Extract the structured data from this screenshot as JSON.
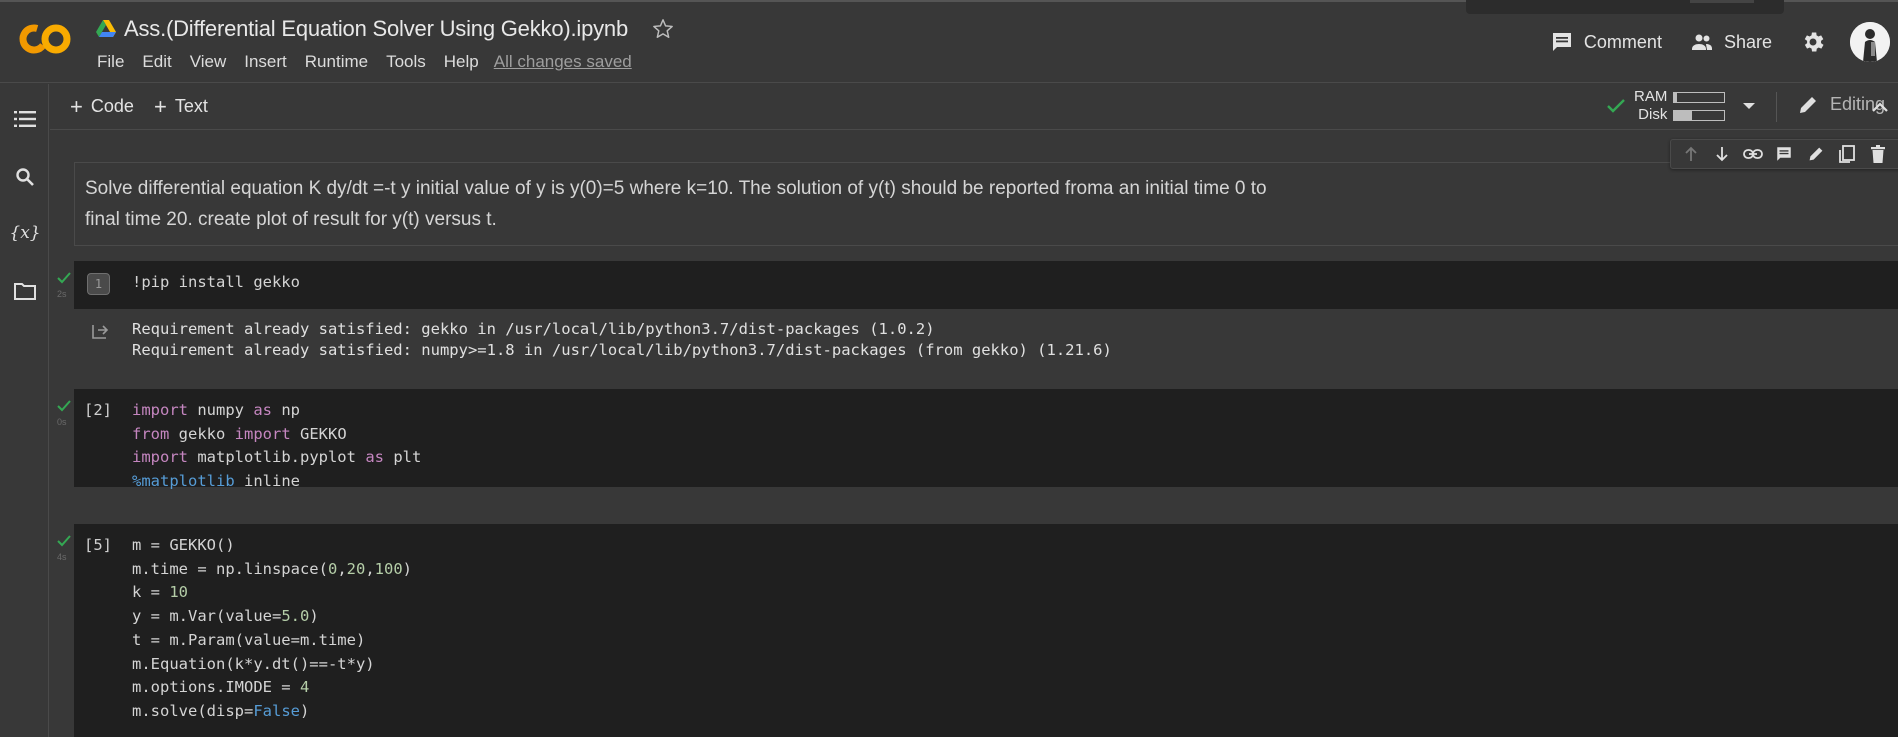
{
  "header": {
    "title": "Ass.(Differential Equation Solver Using Gekko).ipynb",
    "menu": [
      "File",
      "Edit",
      "View",
      "Insert",
      "Runtime",
      "Tools",
      "Help"
    ],
    "save_status": "All changes saved",
    "comment_label": "Comment",
    "share_label": "Share"
  },
  "toolbar": {
    "add_code_label": "Code",
    "add_text_label": "Text",
    "ram_label": "RAM",
    "disk_label": "Disk",
    "ram_usage": 0.05,
    "disk_usage": 0.35,
    "mode_label": "Editing"
  },
  "text_cell": {
    "line1": "Solve differential equation K dy/dt =-t y initial value of y is y(0)=5 where k=10. The solution of y(t) should be reported froma an initial time 0 to",
    "line2": "final time 20. create plot of result for y(t) versus t."
  },
  "cells": {
    "c1": {
      "exec_count": "1",
      "time": "2s",
      "code": "!pip install gekko",
      "output_line1": "Requirement already satisfied: gekko in /usr/local/lib/python3.7/dist-packages (1.0.2)",
      "output_line2": "Requirement already satisfied: numpy>=1.8 in /usr/local/lib/python3.7/dist-packages (from gekko) (1.21.6)"
    },
    "c2": {
      "prompt": "[2]",
      "time": "0s",
      "l1_kw": "import",
      "l1_rest": " numpy ",
      "l1_kw2": "as",
      "l1_end": " np",
      "l2_kw": "from",
      "l2_rest": " gekko ",
      "l2_kw2": "import",
      "l2_end": " GEKKO",
      "l3_kw": "import",
      "l3_rest": " matplotlib.pyplot ",
      "l3_kw2": "as",
      "l3_end": " plt",
      "l4_mag": "%matplotlib",
      "l4_end": " inline"
    },
    "c3": {
      "prompt": "[5]",
      "time": "4s",
      "l1": "m = GEKKO()",
      "l2_a": "m.time = np.linspace(",
      "l2_n1": "0",
      "l2_c1": ",",
      "l2_n2": "20",
      "l2_c2": ",",
      "l2_n3": "100",
      "l2_e": ")",
      "l3_a": "k = ",
      "l3_n": "10",
      "l4_a": "y = m.Var(value=",
      "l4_n": "5.0",
      "l4_e": ")",
      "l5": "t = m.Param(value=m.time)",
      "l6": "m.Equation(k*y.dt()==-t*y)",
      "l7_a": "m.options.IMODE = ",
      "l7_n": "4",
      "l8_a": "m.solve(disp=",
      "l8_b": "False",
      "l8_e": ")"
    }
  },
  "icons": [
    "colab-logo",
    "google-drive-icon",
    "star-icon",
    "comment-icon",
    "people-icon",
    "gear-icon",
    "toc-icon",
    "search-icon",
    "variables-icon",
    "folder-icon",
    "check-icon",
    "pencil-icon",
    "chevron-up-icon",
    "arrow-up-icon",
    "arrow-down-icon",
    "link-icon",
    "comment-icon",
    "edit-icon",
    "mirror-cell-icon",
    "delete-icon",
    "more-vert-icon",
    "output-icon"
  ],
  "colors": {
    "accent": "#f9ab00",
    "logo_orange": "#f29900",
    "run_check": "#34a853",
    "keyword": "#c586c0",
    "number": "#b5cea8",
    "magic": "#569cd6"
  }
}
